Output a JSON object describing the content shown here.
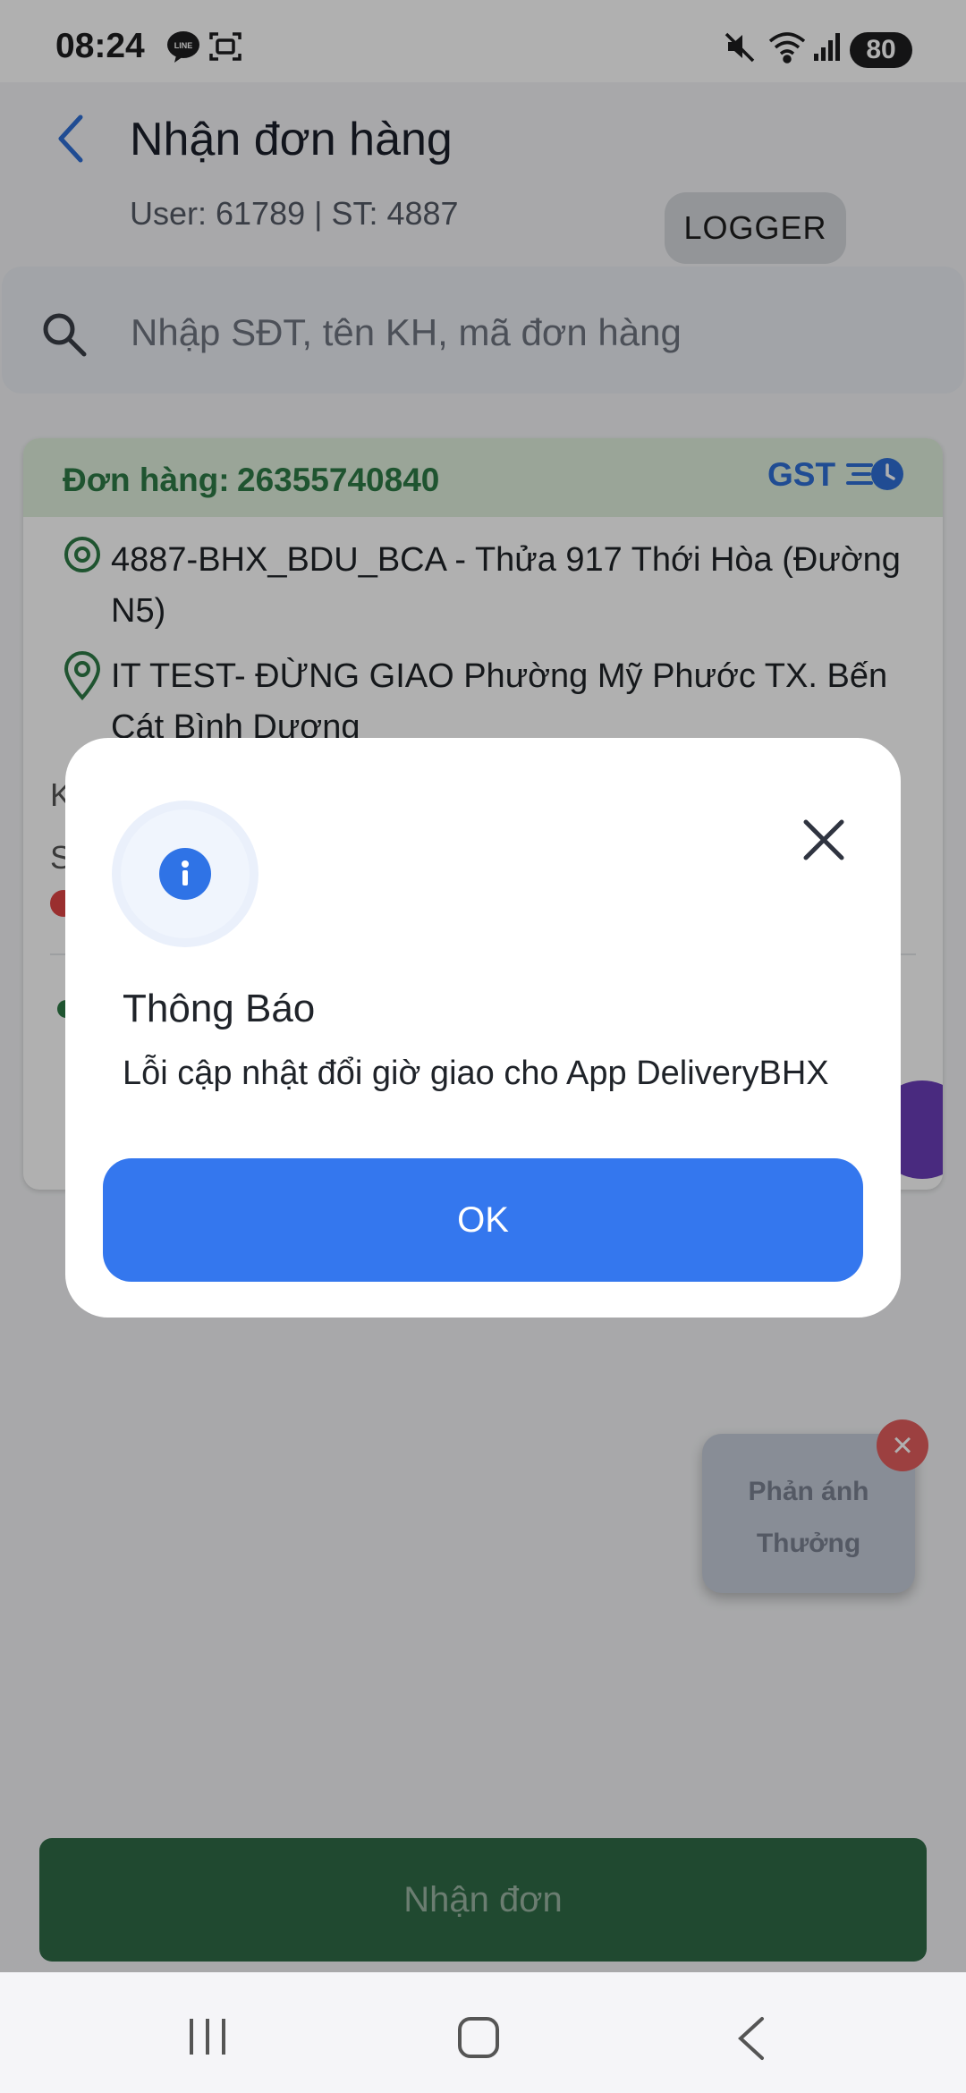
{
  "status_bar": {
    "time": "08:24",
    "battery": "80"
  },
  "header": {
    "title": "Nhận đơn hàng",
    "subtitle": "User: 61789 | ST: 4887",
    "logger_label": "LOGGER"
  },
  "search": {
    "placeholder": "Nhập SĐT, tên KH, mã đơn hàng"
  },
  "order": {
    "label": "Đơn hàng:",
    "id": "26355740840",
    "badge": "GST",
    "pickup": "4887-BHX_BDU_BCA - Thửa 917 Thới Hòa (Đường N5)",
    "delivery": "IT TEST- ĐỪNG GIAO Phường Mỹ Phước TX. Bến Cát Bình Dương",
    "frag_k": "K",
    "frag_s": "S"
  },
  "dialog": {
    "title": "Thông Báo",
    "message": "Lỗi cập nhật đổi giờ giao cho App DeliveryBHX",
    "ok_label": "OK"
  },
  "feedback_widget": {
    "line1": "Phản ánh",
    "line2": "Thưởng"
  },
  "accept_button": {
    "label": "Nhận đơn"
  },
  "colors": {
    "primary_blue": "#3477ee",
    "accept_green": "#2f6b46",
    "order_green": "#2d7a46",
    "gst_blue": "#2f6fd6"
  }
}
